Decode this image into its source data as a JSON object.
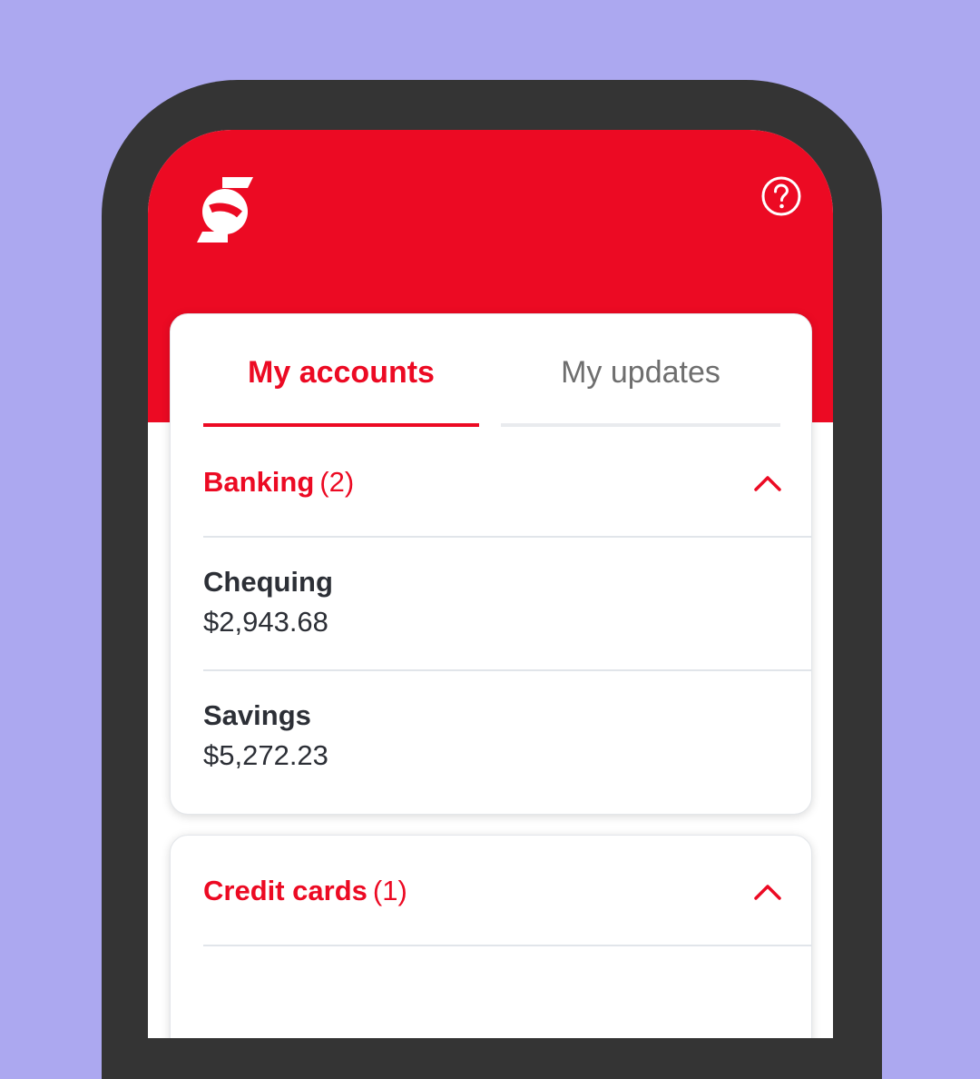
{
  "app": {
    "brand_color": "#ec0a23",
    "background_color": "#aca8f0",
    "logo": "bank-logo",
    "help_icon": "question-circle-icon"
  },
  "tabs": [
    {
      "label": "My accounts",
      "active": true
    },
    {
      "label": "My updates",
      "active": false
    }
  ],
  "sections": [
    {
      "title": "Banking",
      "count": "(2)",
      "expanded": true,
      "icon": "chevron-up-icon",
      "accounts": [
        {
          "name": "Chequing",
          "balance": "$2,943.68"
        },
        {
          "name": "Savings",
          "balance": "$5,272.23"
        }
      ]
    },
    {
      "title": "Credit cards",
      "count": "(1)",
      "expanded": true,
      "icon": "chevron-up-icon",
      "accounts": []
    }
  ]
}
